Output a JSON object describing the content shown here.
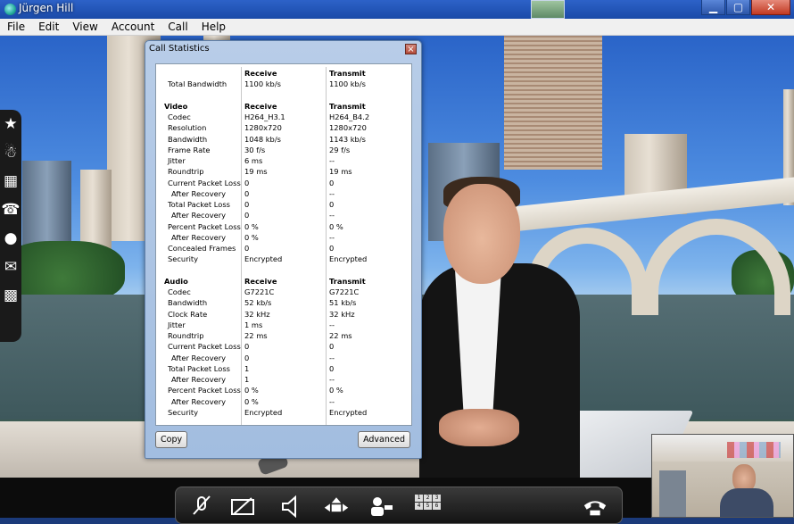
{
  "window": {
    "title": "Jürgen  Hill",
    "controls": {
      "minimize": "▁",
      "maximize": "▢",
      "close": "✕"
    }
  },
  "menu": [
    "File",
    "Edit",
    "View",
    "Account",
    "Call",
    "Help"
  ],
  "dialog": {
    "title": "Call Statistics",
    "close": "×",
    "copy_button": "Copy",
    "advanced_button": "Advanced",
    "header": {
      "receive": "Receive",
      "transmit": "Transmit"
    },
    "total_bandwidth": {
      "label": "Total Bandwidth",
      "receive": "1100 kb/s",
      "transmit": "1100 kb/s"
    },
    "video": {
      "section": "Video",
      "receive": "Receive",
      "transmit": "Transmit",
      "rows": [
        {
          "label": "Codec",
          "receive": "H264_H3.1",
          "transmit": "H264_B4.2"
        },
        {
          "label": "Resolution",
          "receive": "1280x720",
          "transmit": "1280x720"
        },
        {
          "label": "Bandwidth",
          "receive": "1048 kb/s",
          "transmit": "1143 kb/s"
        },
        {
          "label": "Frame Rate",
          "receive": "30 f/s",
          "transmit": "29 f/s"
        },
        {
          "label": "Jitter",
          "receive": "6 ms",
          "transmit": "--"
        },
        {
          "label": "Roundtrip",
          "receive": "19 ms",
          "transmit": "19 ms"
        },
        {
          "label": "Current Packet Loss",
          "receive": "0",
          "transmit": "0"
        },
        {
          "label": "After Recovery",
          "receive": "0",
          "transmit": "--"
        },
        {
          "label": "Total Packet Loss",
          "receive": "0",
          "transmit": "0"
        },
        {
          "label": "After Recovery",
          "receive": "0",
          "transmit": "--"
        },
        {
          "label": "Percent Packet Loss",
          "receive": "0 %",
          "transmit": "0 %"
        },
        {
          "label": "After Recovery",
          "receive": "0 %",
          "transmit": "--"
        },
        {
          "label": "Concealed Frames",
          "receive": "0",
          "transmit": "0"
        },
        {
          "label": "Security",
          "receive": "Encrypted",
          "transmit": "Encrypted"
        }
      ]
    },
    "audio": {
      "section": "Audio",
      "receive": "Receive",
      "transmit": "Transmit",
      "rows": [
        {
          "label": "Codec",
          "receive": "G7221C",
          "transmit": "G7221C"
        },
        {
          "label": "Bandwidth",
          "receive": "52 kb/s",
          "transmit": "51 kb/s"
        },
        {
          "label": "Clock Rate",
          "receive": "32 kHz",
          "transmit": "32 kHz"
        },
        {
          "label": "Jitter",
          "receive": "1 ms",
          "transmit": "--"
        },
        {
          "label": "Roundtrip",
          "receive": "22 ms",
          "transmit": "22 ms"
        },
        {
          "label": "Current Packet Loss",
          "receive": "0",
          "transmit": "0"
        },
        {
          "label": "After Recovery",
          "receive": "0",
          "transmit": "--"
        },
        {
          "label": "Total Packet Loss",
          "receive": "1",
          "transmit": "0"
        },
        {
          "label": "After Recovery",
          "receive": "1",
          "transmit": "--"
        },
        {
          "label": "Percent Packet Loss",
          "receive": "0 %",
          "transmit": "0 %"
        },
        {
          "label": "After Recovery",
          "receive": "0 %",
          "transmit": "--"
        },
        {
          "label": "Security",
          "receive": "Encrypted",
          "transmit": "Encrypted"
        }
      ]
    }
  },
  "sidebar_icons": [
    "star-icon",
    "contacts-icon",
    "calendar-icon",
    "directory-icon",
    "chat-icon",
    "mail-icon",
    "grid-icon"
  ],
  "controlbar": {
    "icons": [
      "mute-microphone-icon",
      "camera-off-icon",
      "volume-icon",
      "camera-pan-icon",
      "far-end-camera-icon",
      "keypad-icon",
      "hang-up-icon"
    ],
    "keypad_digits": [
      "1",
      "2",
      "3",
      "4",
      "5",
      "6"
    ]
  }
}
